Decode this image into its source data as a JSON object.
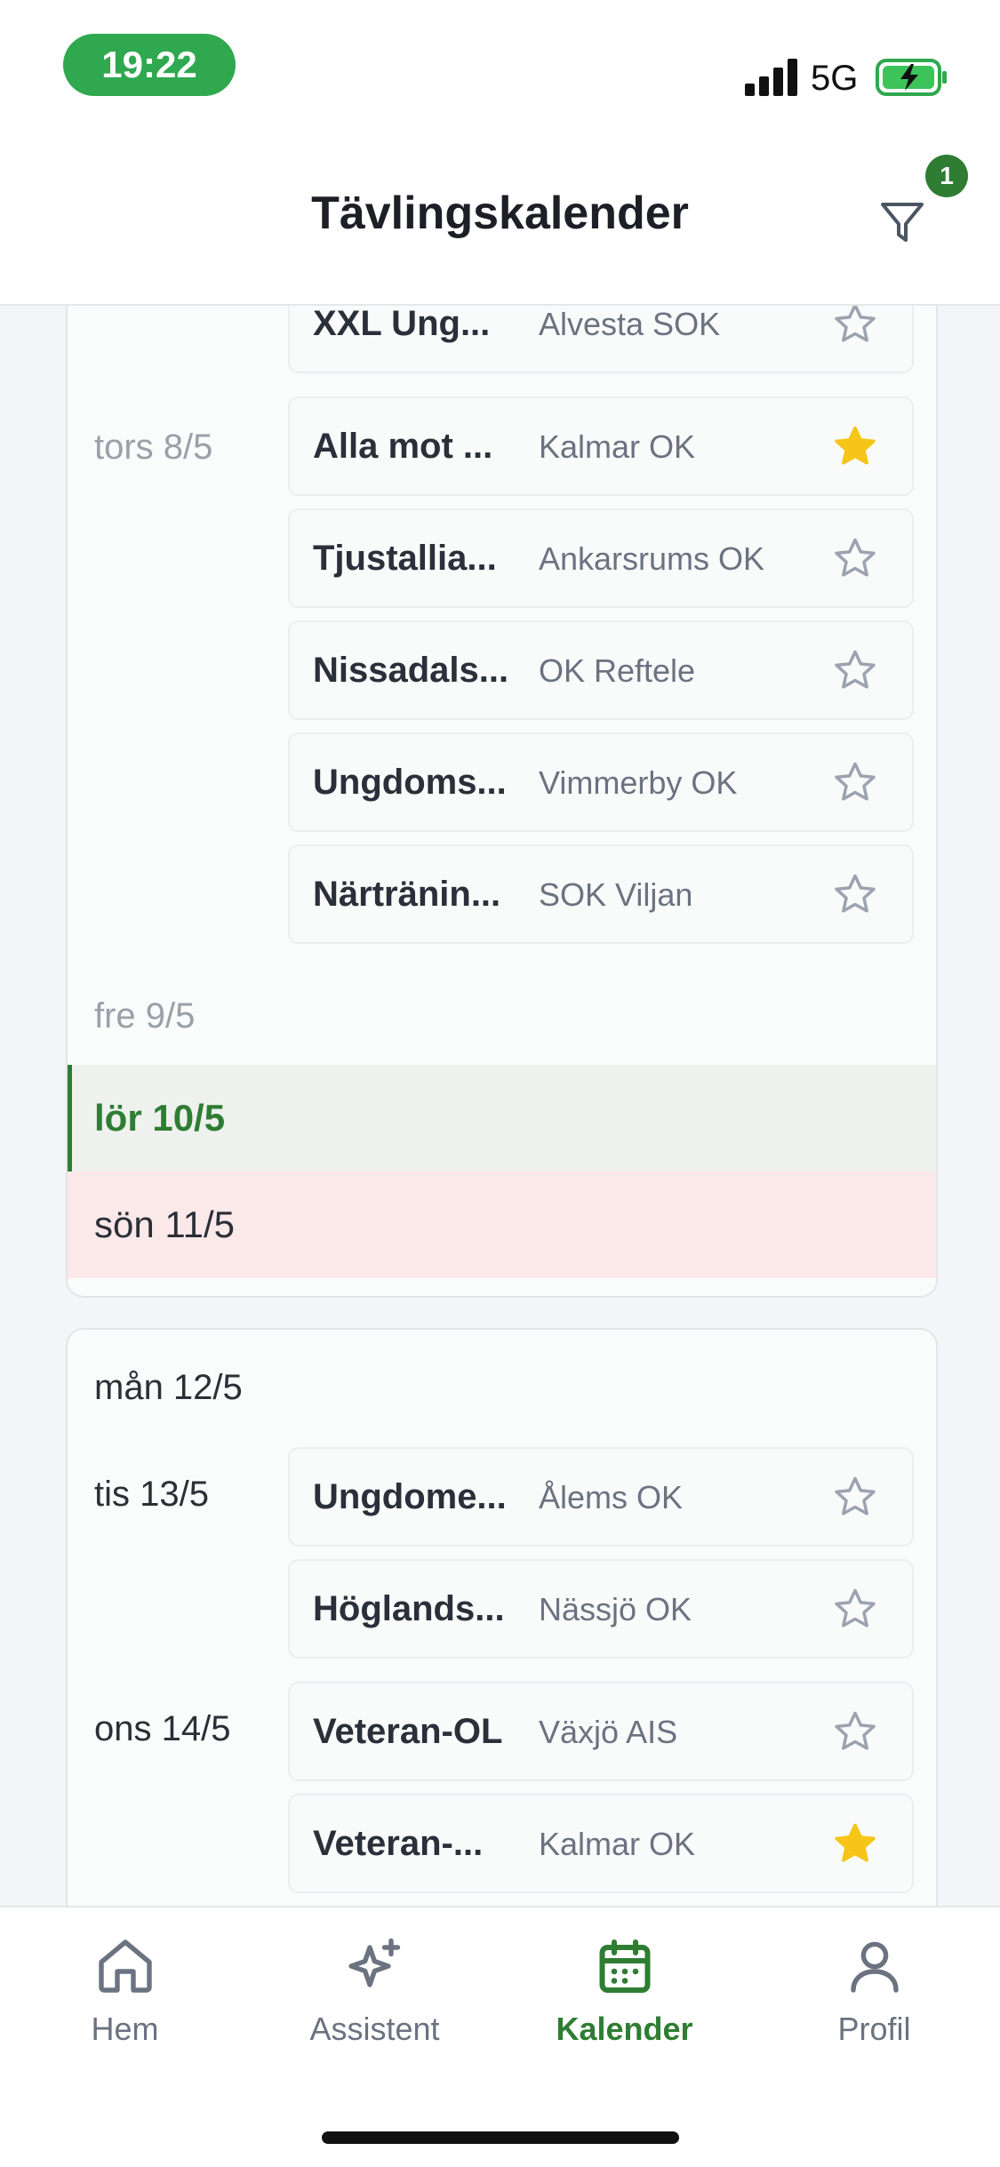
{
  "status_bar": {
    "time": "19:22",
    "network": "5G"
  },
  "header": {
    "title": "Tävlingskalender",
    "filter_badge_count": "1"
  },
  "colors": {
    "accent": "#2e7d32",
    "star_active": "#f5c518",
    "sunday_bg": "#fbe9ea",
    "saturday_bg": "#eef1ee"
  },
  "week1": {
    "partial_event": {
      "name": "XXL Ung...",
      "club": "Alvesta SOK",
      "starred": false
    },
    "thu": {
      "label": "tors 8/5",
      "events": [
        {
          "name": "Alla mot ...",
          "club": "Kalmar OK",
          "starred": true
        },
        {
          "name": "Tjustallia...",
          "club": "Ankarsrums OK",
          "starred": false
        },
        {
          "name": "Nissadals...",
          "club": "OK Reftele",
          "starred": false
        },
        {
          "name": "Ungdoms...",
          "club": "Vimmerby OK",
          "starred": false
        },
        {
          "name": "Närtränin...",
          "club": "SOK Viljan",
          "starred": false
        }
      ]
    },
    "fri": {
      "label": "fre 9/5"
    },
    "sat": {
      "label": "lör 10/5"
    },
    "sun": {
      "label": "sön 11/5"
    }
  },
  "week2": {
    "mon": {
      "label": "mån 12/5"
    },
    "tue": {
      "label": "tis 13/5",
      "events": [
        {
          "name": "Ungdome...",
          "club": "Ålems OK",
          "starred": false
        },
        {
          "name": "Höglands...",
          "club": "Nässjö OK",
          "starred": false
        }
      ]
    },
    "wed": {
      "label": "ons 14/5",
      "events": [
        {
          "name": "Veteran-OL",
          "club": "Växjö AIS",
          "starred": false
        },
        {
          "name": "Veteran-...",
          "club": "Kalmar OK",
          "starred": true
        }
      ]
    }
  },
  "tabs": [
    {
      "label": "Hem",
      "icon": "home-icon",
      "active": false
    },
    {
      "label": "Assistent",
      "icon": "sparkles-icon",
      "active": false
    },
    {
      "label": "Kalender",
      "icon": "calendar-icon",
      "active": true
    },
    {
      "label": "Profil",
      "icon": "user-icon",
      "active": false
    }
  ]
}
